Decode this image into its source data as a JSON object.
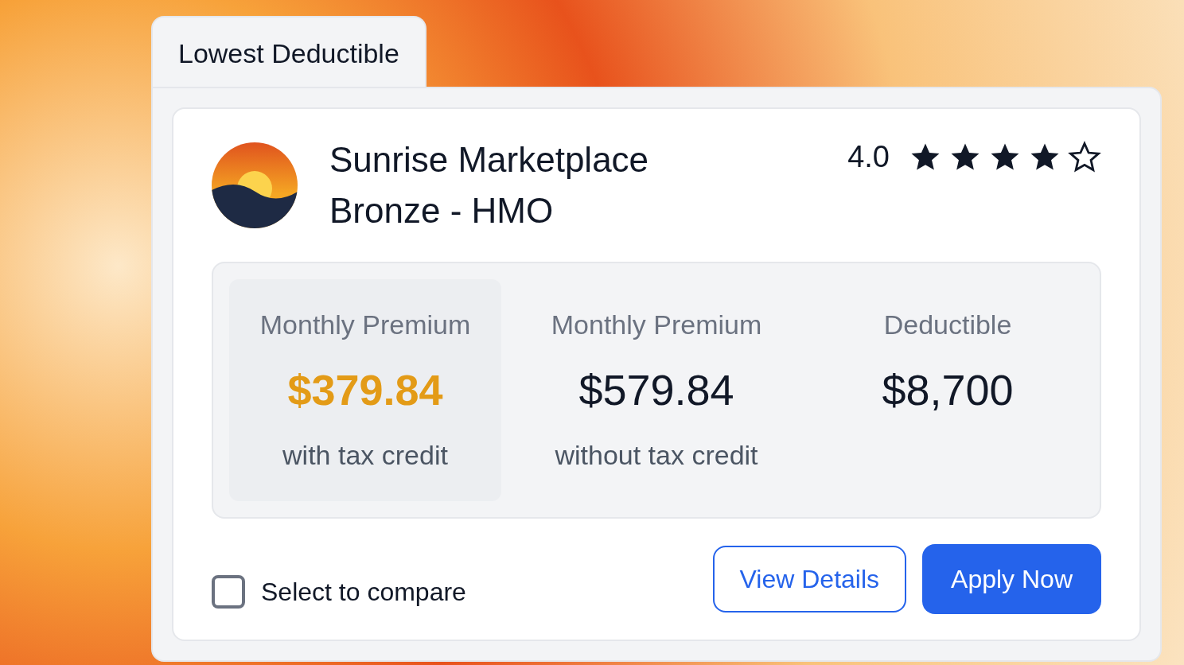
{
  "tab": {
    "label": "Lowest Deductible"
  },
  "plan": {
    "name": "Sunrise Marketplace Bronze - HMO",
    "rating": "4.0",
    "stars": 4
  },
  "costs": [
    {
      "label": "Monthly Premium",
      "value": "$379.84",
      "note": "with tax credit",
      "highlighted": true
    },
    {
      "label": "Monthly Premium",
      "value": "$579.84",
      "note": "without tax credit",
      "highlighted": false
    },
    {
      "label": "Deductible",
      "value": "$8,700",
      "highlighted": false
    }
  ],
  "buttons": [
    {
      "label": "View Details",
      "kind": "outline"
    },
    {
      "label": "Apply Now",
      "kind": "primary"
    }
  ],
  "compare": {
    "label": "Select to compare",
    "checked": false
  }
}
